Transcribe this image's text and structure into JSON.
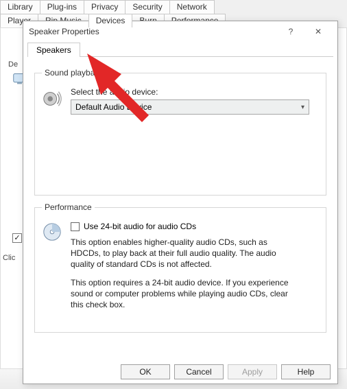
{
  "bg": {
    "tabs_row1": [
      "Library",
      "Plug-ins",
      "Privacy",
      "Security",
      "Network"
    ],
    "tabs_row2": [
      "Player",
      "Rip Music",
      "Devices",
      "Burn",
      "Performance"
    ],
    "active_tab": "Devices",
    "dev_label": "De",
    "click_label": "Clic",
    "checkbox_checked": true
  },
  "dialog": {
    "title": "Speaker Properties",
    "help_glyph": "?",
    "close_glyph": "✕",
    "tab_label": "Speakers",
    "sound_group": {
      "legend": "Sound playback",
      "instruction": "Select the audio device:",
      "combo_value": "Default Audio Device"
    },
    "perf_group": {
      "legend": "Performance",
      "checkbox_label": "Use 24-bit audio for audio CDs",
      "para1": "This option enables higher-quality audio CDs, such as HDCDs, to play back at their full audio quality. The audio quality of standard CDs is not affected.",
      "para2": "This option requires a 24-bit audio device. If you experience sound or computer problems while playing audio CDs, clear this check box."
    },
    "buttons": {
      "ok": "OK",
      "cancel": "Cancel",
      "apply": "Apply",
      "help": "Help"
    }
  },
  "annotation": {
    "color": "#e22727"
  }
}
